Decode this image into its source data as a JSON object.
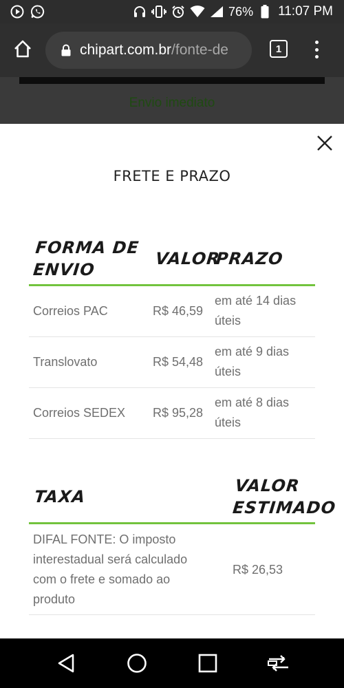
{
  "status_bar": {
    "battery": "76%",
    "time": "11:07 PM",
    "icons": [
      "play-circle-icon",
      "whatsapp-icon",
      "headphones-icon",
      "vibrate-icon",
      "alarm-icon",
      "wifi-icon",
      "signal-icon",
      "battery-icon"
    ]
  },
  "browser": {
    "url_domain": "chipart.com.br",
    "url_path": "/fonte-de",
    "tab_count": "1"
  },
  "page_behind": {
    "text": "Envio imediato"
  },
  "modal": {
    "title": "FRETE E PRAZO",
    "shipping_table": {
      "headers": [
        "FORMA DE ENVIO",
        "VALOR",
        "PRAZO"
      ],
      "header_line1": "FORMA DE",
      "header_line2": "ENVIO",
      "rows": [
        {
          "method": "Correios PAC",
          "value": "R$ 46,59",
          "deadline_line1": "em até 14 dias",
          "deadline_line2": "úteis"
        },
        {
          "method": "Translovato",
          "value": "R$ 54,48",
          "deadline_line1": "em até 9 dias",
          "deadline_line2": "úteis"
        },
        {
          "method": "Correios SEDEX",
          "value": "R$ 95,28",
          "deadline_line1": "em até 8 dias",
          "deadline_line2": "úteis"
        }
      ]
    },
    "tax_table": {
      "header_tax": "TAXA",
      "header_value_line1": "VALOR",
      "header_value_line2": "ESTIMADO",
      "rows": [
        {
          "desc_line1": "DIFAL FONTE: O imposto",
          "desc_line2": "interestadual será calculado",
          "desc_line3": "com o frete e somado ao",
          "desc_line4": "produto",
          "value": "R$ 26,53"
        }
      ]
    }
  },
  "colors": {
    "accent_green": "#72c33d",
    "status_bar_bg": "#2d2d2d",
    "nav_bg": "#000000"
  }
}
